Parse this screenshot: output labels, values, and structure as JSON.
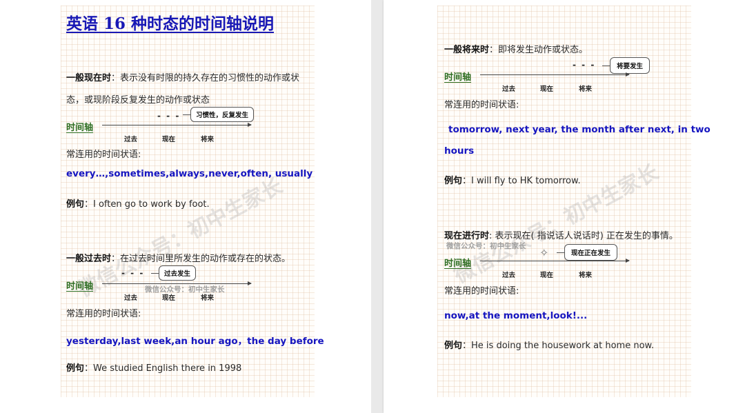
{
  "left_page": {
    "title": "英语 16 种时态的时间轴说明",
    "watermark_diagonal": "微信公众号：初中生家长",
    "simple_present": {
      "heading": "一般现在时",
      "desc_1": "：表示没有时限的持久存在的习惯性的动作或状",
      "desc_2": "态，或现阶段反复发生的动作或状态",
      "bubble": "习惯性，反复发生",
      "dash": "- - -",
      "axis_label": "时间轴",
      "ticks": [
        "过去",
        "现在",
        "将来"
      ],
      "adverbials_label": "常连用的时间状语:",
      "adverbials": "every…,sometimes,always,never,often, usually",
      "example_label": "例句",
      "example_text": "：I often go to work by foot."
    },
    "simple_past": {
      "heading": "一般过去时",
      "desc": "：在过去时间里所发生的动作或存在的状态。",
      "bubble": "过去发生",
      "dash": "- - -",
      "axis_label": "时间轴",
      "ticks": [
        "过去",
        "现在",
        "将来"
      ],
      "watermark_small": "微信公众号：初中生家长",
      "adverbials_label": "常连用的时间状语:",
      "adverbials": "yesterday,last week,an hour ago，the day before",
      "example_label": "例句",
      "example_text": "：We studied English there in 1998"
    }
  },
  "right_page": {
    "watermark_diagonal": "微信公众号：初中生家长",
    "simple_future": {
      "heading": "一般将来时",
      "desc": "：即将发生动作或状态。",
      "bubble": "将要发生",
      "dash": "- - -",
      "axis_label": "时间轴",
      "ticks": [
        "过去",
        "现在",
        "将来"
      ],
      "adverbials_label": "常连用的时间状语:",
      "adverbials_1": "tomorrow, next year, the month after next, in two",
      "adverbials_2": "hours",
      "example_label": "例句",
      "example_text": "：I will fly to HK tomorrow."
    },
    "present_progressive": {
      "heading": "现在进行时",
      "desc": ": 表示现在( 指说话人说话时) 正在发生的事情。",
      "watermark_small": "微信公众号：初中生家长",
      "bubble": "现在正在发生",
      "axis_label": "时间轴",
      "ticks": [
        "过去",
        "现在",
        "将来"
      ],
      "adverbials_label": "常连用的时间状语:",
      "adverbials": "now,at the moment,look!...",
      "example_label": "例句",
      "example_text": "：He is doing the housework at home now."
    }
  }
}
